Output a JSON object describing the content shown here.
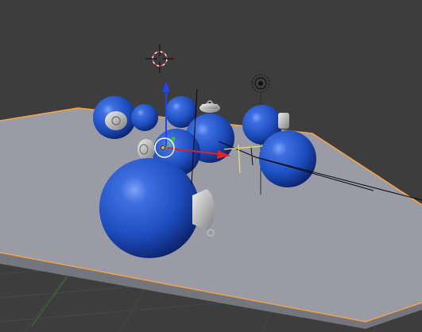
{
  "viewport": {
    "background_color": "#3d3d3d",
    "grid_color": "#4a4a4a",
    "axis_x_line_color": "#6b3a3a",
    "axis_y_line_color": "#3f6a2a"
  },
  "floor": {
    "top_color": "#9b9ba6",
    "side_color": "#75757e",
    "selection_outline_color": "#f5a545"
  },
  "ornaments": {
    "color": "#1e4fc0",
    "highlight_color": "#6b93ee",
    "shadow_color": "#0b2470",
    "cap_color": "#c6c6c6"
  },
  "gizmo": {
    "x_axis_color": "#d8252a",
    "z_axis_color": "#2244ee",
    "y_axis_color": "#34c334",
    "center_ring_color": "#ffffff"
  },
  "icons": {
    "cursor": "3d-cursor-icon",
    "light": "lamp-icon",
    "camera": "camera-icon"
  }
}
